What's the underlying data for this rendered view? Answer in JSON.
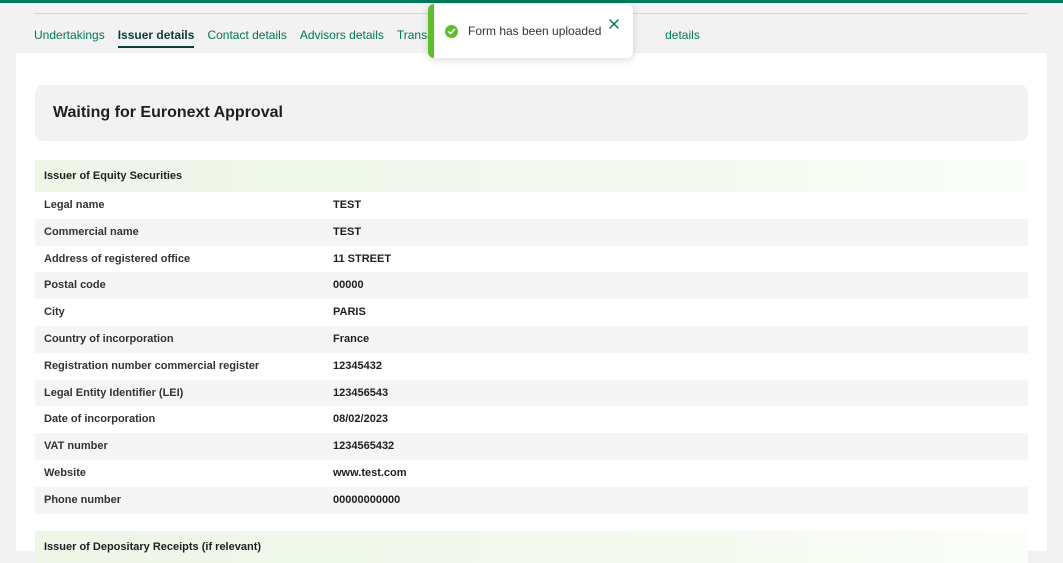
{
  "tabs": [
    {
      "label": "Undertakings"
    },
    {
      "label": "Issuer details"
    },
    {
      "label": "Contact details"
    },
    {
      "label": "Advisors details"
    },
    {
      "label": "Transaction"
    },
    {
      "label": "details"
    }
  ],
  "status": {
    "title": "Waiting for Euronext Approval"
  },
  "section_equity": {
    "title": "Issuer of Equity Securities"
  },
  "section_depositary": {
    "title": "Issuer of Depositary Receipts (if relevant)"
  },
  "fields": [
    {
      "label": "Legal name",
      "value": "TEST"
    },
    {
      "label": "Commercial name",
      "value": "TEST"
    },
    {
      "label": "Address of registered office",
      "value": "11 STREET"
    },
    {
      "label": "Postal code",
      "value": "00000"
    },
    {
      "label": "City",
      "value": "PARIS"
    },
    {
      "label": "Country of incorporation",
      "value": "France"
    },
    {
      "label": "Registration number commercial register",
      "value": "12345432"
    },
    {
      "label": "Legal Entity Identifier (LEI)",
      "value": "123456543"
    },
    {
      "label": "Date of incorporation",
      "value": "08/02/2023"
    },
    {
      "label": "VAT number",
      "value": "1234565432"
    },
    {
      "label": "Website",
      "value": "www.test.com"
    },
    {
      "label": "Phone number",
      "value": "00000000000"
    }
  ],
  "toast": {
    "message": "Form has been uploaded",
    "icon": "check-circle-icon",
    "close_icon": "close-icon"
  },
  "colors": {
    "accent": "#00785a",
    "success": "#5fbf2a"
  }
}
